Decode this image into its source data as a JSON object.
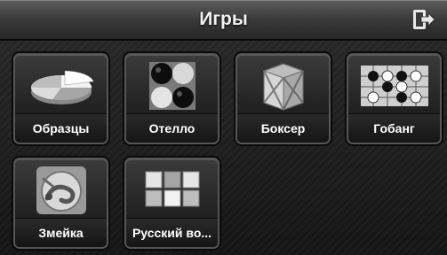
{
  "header": {
    "title": "Игры",
    "exit_icon": "exit-icon"
  },
  "games": [
    {
      "label": "Образцы",
      "icon": "pie-chart-icon"
    },
    {
      "label": "Отелло",
      "icon": "othello-discs-icon"
    },
    {
      "label": "Боксер",
      "icon": "crate-box-icon"
    },
    {
      "label": "Гобанг",
      "icon": "gomoku-board-icon"
    },
    {
      "label": "Змейка",
      "icon": "snake-icon"
    },
    {
      "label": "Русский во...",
      "icon": "block-puzzle-icon"
    }
  ]
}
